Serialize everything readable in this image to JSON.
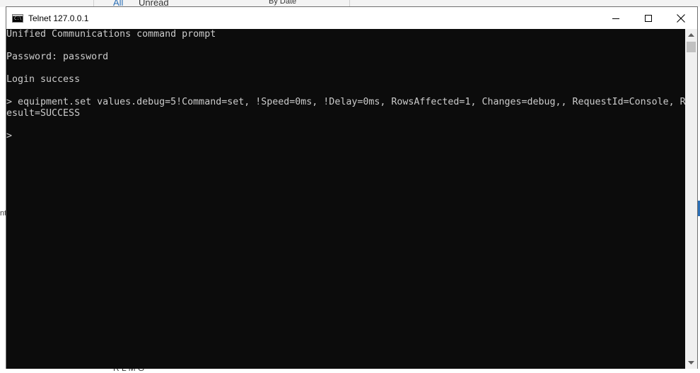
{
  "window": {
    "title": "Telnet 127.0.0.1"
  },
  "console": {
    "lines": [
      "Unified Communications command prompt",
      "",
      "Password: password",
      "",
      "Login success",
      "",
      "> equipment.set values.debug=5!Command=set, !Speed=0ms, !Delay=0ms, RowsAffected=1, Changes=debug,, RequestId=Console, R",
      "esult=SUCCESS",
      "",
      ">"
    ]
  },
  "background": {
    "top_fragment_1": "All",
    "top_fragment_2": "Unread",
    "top_fragment_3": "By Date",
    "left_fragment": "nt",
    "bottom_fragment_1": "R L M G"
  },
  "colors": {
    "console_bg": "#0c0c0c",
    "console_fg": "#cccccc",
    "titlebar_bg": "#ffffff"
  },
  "icons": {
    "window_icon": "console-icon",
    "minimize": "minimize-icon",
    "maximize": "maximize-icon",
    "close": "close-icon"
  }
}
